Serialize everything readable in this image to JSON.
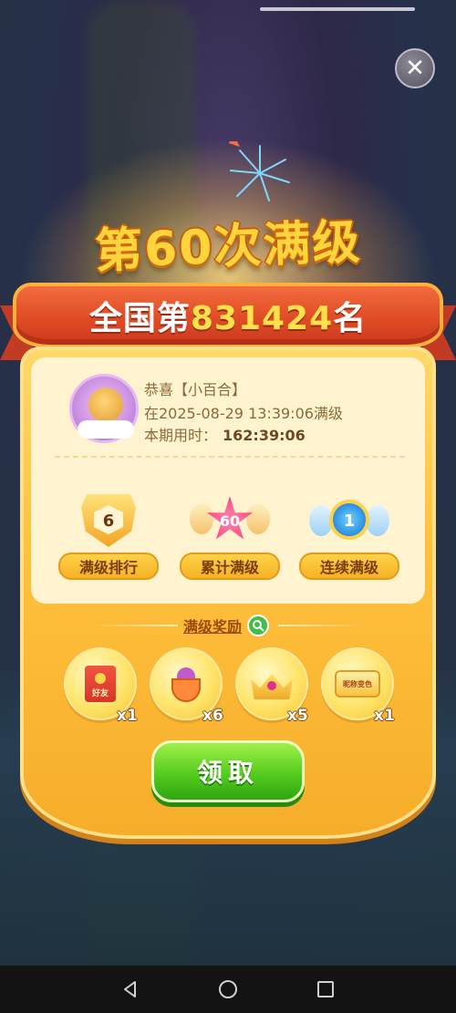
{
  "header": {
    "close_icon": "close-icon",
    "title": "第60次满级",
    "rank_prefix": "全国第",
    "rank_value": "831424",
    "rank_suffix": "名"
  },
  "profile": {
    "congrats_line": "恭喜【小百合】",
    "time_line": "在2025-08-29 13:39:06满级",
    "duration_label": "本期用时：",
    "duration_value": "162:39:06"
  },
  "stats": [
    {
      "label": "满级排行",
      "value": "6"
    },
    {
      "label": "累计满级",
      "value": "60"
    },
    {
      "label": "连续满级",
      "value": "1"
    }
  ],
  "rewards": {
    "title": "满级奖励",
    "items": [
      {
        "icon": "red-envelope-icon",
        "text": "好友",
        "count": "x1"
      },
      {
        "icon": "fruit-pot-icon",
        "count": "x6"
      },
      {
        "icon": "crown-icon",
        "count": "x5"
      },
      {
        "icon": "name-color-card-icon",
        "text": "昵称变色",
        "count": "x1"
      }
    ]
  },
  "actions": {
    "claim_label": "领取"
  },
  "colors": {
    "title_gold": "#ffd53d",
    "ribbon_red": "#e04c26",
    "rank_yellow": "#ffe14a",
    "panel_gold": "#ffc23e",
    "claim_green": "#55cc1d"
  }
}
